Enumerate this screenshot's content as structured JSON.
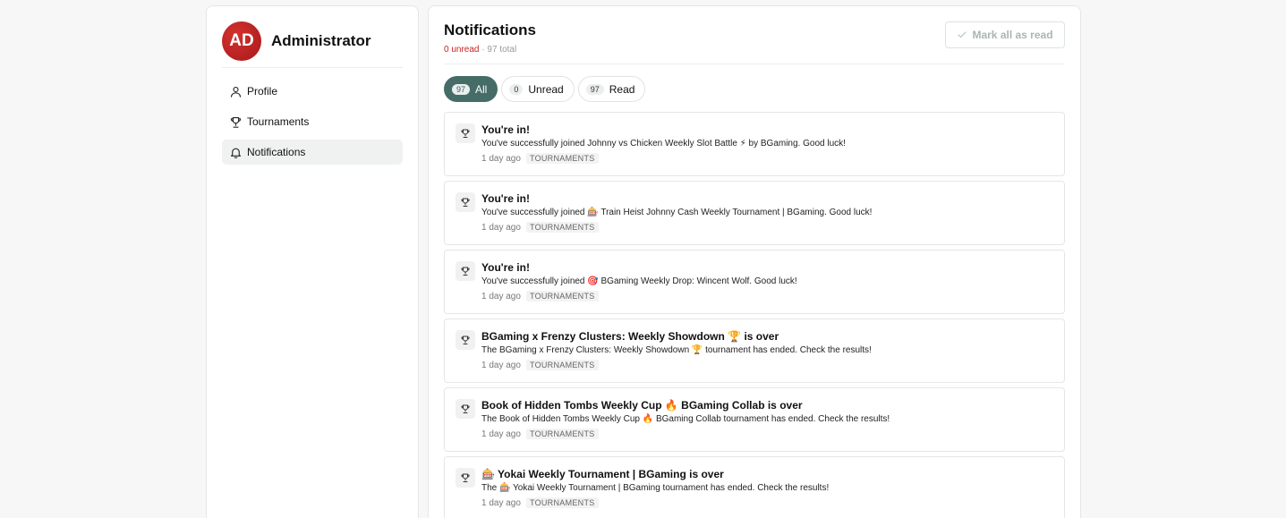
{
  "sidebar": {
    "avatar_initials": "AD",
    "user_name": "Administrator",
    "nav": [
      {
        "label": "Profile",
        "icon": "user-icon"
      },
      {
        "label": "Tournaments",
        "icon": "trophy-icon"
      },
      {
        "label": "Notifications",
        "icon": "bell-icon",
        "active": true
      }
    ]
  },
  "header": {
    "title": "Notifications",
    "unread_text": "0 unread",
    "separator": "·",
    "total_text": "97 total",
    "mark_all_label": "Mark all as read"
  },
  "tabs": [
    {
      "count": "97",
      "label": "All",
      "active": true
    },
    {
      "count": "0",
      "label": "Unread"
    },
    {
      "count": "97",
      "label": "Read"
    }
  ],
  "notifications": [
    {
      "title": "You're in!",
      "body": "You've successfully joined Johnny vs Chicken Weekly Slot Battle ⚡ by BGaming. Good luck!",
      "time": "1 day ago",
      "tag": "TOURNAMENTS"
    },
    {
      "title": "You're in!",
      "body": "You've successfully joined 🎰 Train Heist Johnny Cash Weekly Tournament | BGaming. Good luck!",
      "time": "1 day ago",
      "tag": "TOURNAMENTS"
    },
    {
      "title": "You're in!",
      "body": "You've successfully joined 🎯 BGaming Weekly Drop: Wincent Wolf. Good luck!",
      "time": "1 day ago",
      "tag": "TOURNAMENTS"
    },
    {
      "title": "BGaming x Frenzy Clusters: Weekly Showdown 🏆 is over",
      "body": "The BGaming x Frenzy Clusters: Weekly Showdown 🏆 tournament has ended. Check the results!",
      "time": "1 day ago",
      "tag": "TOURNAMENTS"
    },
    {
      "title": "Book of Hidden Tombs Weekly Cup 🔥 BGaming Collab is over",
      "body": "The Book of Hidden Tombs Weekly Cup 🔥 BGaming Collab tournament has ended. Check the results!",
      "time": "1 day ago",
      "tag": "TOURNAMENTS"
    },
    {
      "title": "🎰 Yokai Weekly Tournament | BGaming is over",
      "body": "The 🎰 Yokai Weekly Tournament | BGaming tournament has ended. Check the results!",
      "time": "1 day ago",
      "tag": "TOURNAMENTS"
    }
  ]
}
